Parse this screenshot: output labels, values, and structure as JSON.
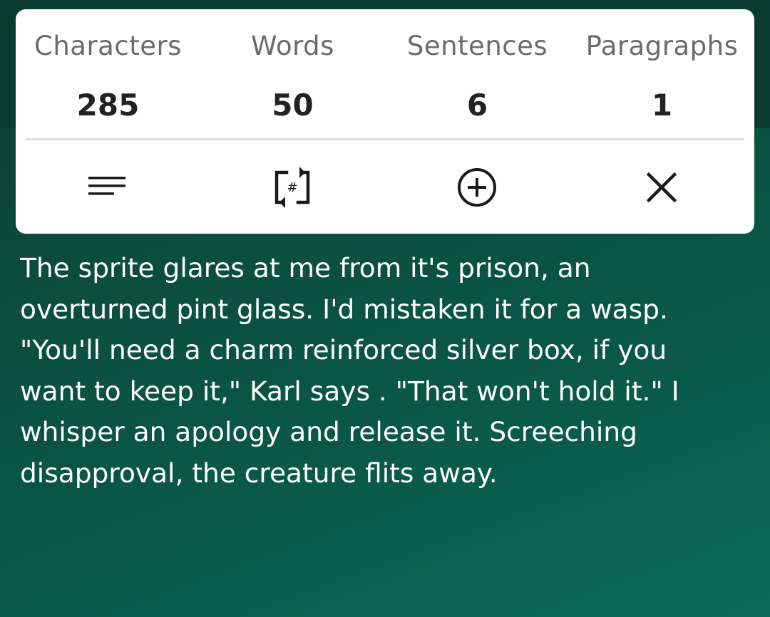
{
  "stats": {
    "characters": {
      "label": "Characters",
      "value": "285"
    },
    "words": {
      "label": "Words",
      "value": "50"
    },
    "sentences": {
      "label": "Sentences",
      "value": "6"
    },
    "paragraphs": {
      "label": "Paragraphs",
      "value": "1"
    }
  },
  "actions": [
    {
      "icon": "text-lines-icon"
    },
    {
      "icon": "hashtag-refresh-icon"
    },
    {
      "icon": "add-circle-icon"
    },
    {
      "icon": "close-icon"
    }
  ],
  "story": {
    "text": "The sprite glares at me from it's prison, an overturned pint glass. I'd mistaken it for a wasp. \"You'll need a charm reinforced silver box, if you want to keep it,\" Karl says . \"That won't hold it.\" I whisper an apology and release it. Screeching disapproval, the creature flits away."
  },
  "colors": {
    "background_top": "#0a3a30",
    "background_bottom": "#0c6a57",
    "card": "#ffffff",
    "label": "#6b6b6b",
    "value": "#222222"
  }
}
